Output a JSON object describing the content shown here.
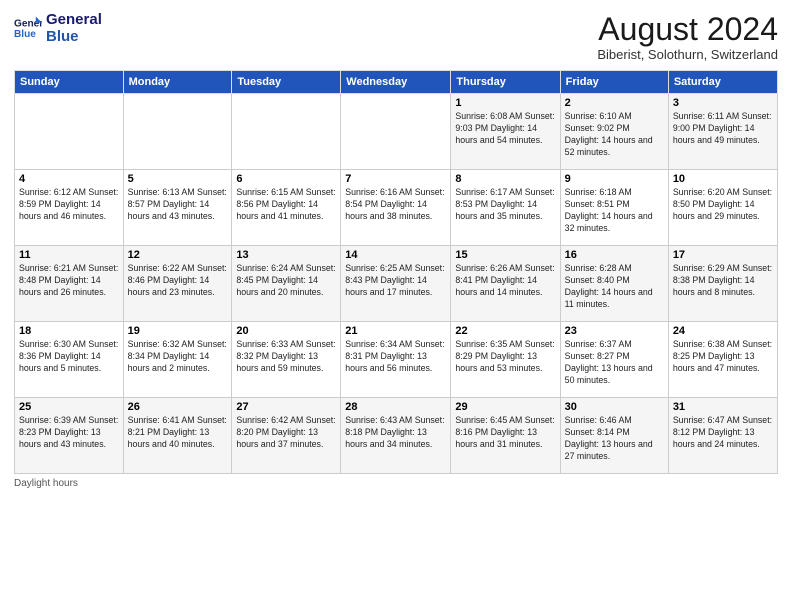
{
  "app": {
    "logo_line1": "General",
    "logo_line2": "Blue"
  },
  "header": {
    "month_year": "August 2024",
    "location": "Biberist, Solothurn, Switzerland"
  },
  "weekdays": [
    "Sunday",
    "Monday",
    "Tuesday",
    "Wednesday",
    "Thursday",
    "Friday",
    "Saturday"
  ],
  "footer": {
    "daylight_label": "Daylight hours"
  },
  "weeks": [
    [
      {
        "day": "",
        "info": ""
      },
      {
        "day": "",
        "info": ""
      },
      {
        "day": "",
        "info": ""
      },
      {
        "day": "",
        "info": ""
      },
      {
        "day": "1",
        "info": "Sunrise: 6:08 AM\nSunset: 9:03 PM\nDaylight: 14 hours\nand 54 minutes."
      },
      {
        "day": "2",
        "info": "Sunrise: 6:10 AM\nSunset: 9:02 PM\nDaylight: 14 hours\nand 52 minutes."
      },
      {
        "day": "3",
        "info": "Sunrise: 6:11 AM\nSunset: 9:00 PM\nDaylight: 14 hours\nand 49 minutes."
      }
    ],
    [
      {
        "day": "4",
        "info": "Sunrise: 6:12 AM\nSunset: 8:59 PM\nDaylight: 14 hours\nand 46 minutes."
      },
      {
        "day": "5",
        "info": "Sunrise: 6:13 AM\nSunset: 8:57 PM\nDaylight: 14 hours\nand 43 minutes."
      },
      {
        "day": "6",
        "info": "Sunrise: 6:15 AM\nSunset: 8:56 PM\nDaylight: 14 hours\nand 41 minutes."
      },
      {
        "day": "7",
        "info": "Sunrise: 6:16 AM\nSunset: 8:54 PM\nDaylight: 14 hours\nand 38 minutes."
      },
      {
        "day": "8",
        "info": "Sunrise: 6:17 AM\nSunset: 8:53 PM\nDaylight: 14 hours\nand 35 minutes."
      },
      {
        "day": "9",
        "info": "Sunrise: 6:18 AM\nSunset: 8:51 PM\nDaylight: 14 hours\nand 32 minutes."
      },
      {
        "day": "10",
        "info": "Sunrise: 6:20 AM\nSunset: 8:50 PM\nDaylight: 14 hours\nand 29 minutes."
      }
    ],
    [
      {
        "day": "11",
        "info": "Sunrise: 6:21 AM\nSunset: 8:48 PM\nDaylight: 14 hours\nand 26 minutes."
      },
      {
        "day": "12",
        "info": "Sunrise: 6:22 AM\nSunset: 8:46 PM\nDaylight: 14 hours\nand 23 minutes."
      },
      {
        "day": "13",
        "info": "Sunrise: 6:24 AM\nSunset: 8:45 PM\nDaylight: 14 hours\nand 20 minutes."
      },
      {
        "day": "14",
        "info": "Sunrise: 6:25 AM\nSunset: 8:43 PM\nDaylight: 14 hours\nand 17 minutes."
      },
      {
        "day": "15",
        "info": "Sunrise: 6:26 AM\nSunset: 8:41 PM\nDaylight: 14 hours\nand 14 minutes."
      },
      {
        "day": "16",
        "info": "Sunrise: 6:28 AM\nSunset: 8:40 PM\nDaylight: 14 hours\nand 11 minutes."
      },
      {
        "day": "17",
        "info": "Sunrise: 6:29 AM\nSunset: 8:38 PM\nDaylight: 14 hours\nand 8 minutes."
      }
    ],
    [
      {
        "day": "18",
        "info": "Sunrise: 6:30 AM\nSunset: 8:36 PM\nDaylight: 14 hours\nand 5 minutes."
      },
      {
        "day": "19",
        "info": "Sunrise: 6:32 AM\nSunset: 8:34 PM\nDaylight: 14 hours\nand 2 minutes."
      },
      {
        "day": "20",
        "info": "Sunrise: 6:33 AM\nSunset: 8:32 PM\nDaylight: 13 hours\nand 59 minutes."
      },
      {
        "day": "21",
        "info": "Sunrise: 6:34 AM\nSunset: 8:31 PM\nDaylight: 13 hours\nand 56 minutes."
      },
      {
        "day": "22",
        "info": "Sunrise: 6:35 AM\nSunset: 8:29 PM\nDaylight: 13 hours\nand 53 minutes."
      },
      {
        "day": "23",
        "info": "Sunrise: 6:37 AM\nSunset: 8:27 PM\nDaylight: 13 hours\nand 50 minutes."
      },
      {
        "day": "24",
        "info": "Sunrise: 6:38 AM\nSunset: 8:25 PM\nDaylight: 13 hours\nand 47 minutes."
      }
    ],
    [
      {
        "day": "25",
        "info": "Sunrise: 6:39 AM\nSunset: 8:23 PM\nDaylight: 13 hours\nand 43 minutes."
      },
      {
        "day": "26",
        "info": "Sunrise: 6:41 AM\nSunset: 8:21 PM\nDaylight: 13 hours\nand 40 minutes."
      },
      {
        "day": "27",
        "info": "Sunrise: 6:42 AM\nSunset: 8:20 PM\nDaylight: 13 hours\nand 37 minutes."
      },
      {
        "day": "28",
        "info": "Sunrise: 6:43 AM\nSunset: 8:18 PM\nDaylight: 13 hours\nand 34 minutes."
      },
      {
        "day": "29",
        "info": "Sunrise: 6:45 AM\nSunset: 8:16 PM\nDaylight: 13 hours\nand 31 minutes."
      },
      {
        "day": "30",
        "info": "Sunrise: 6:46 AM\nSunset: 8:14 PM\nDaylight: 13 hours\nand 27 minutes."
      },
      {
        "day": "31",
        "info": "Sunrise: 6:47 AM\nSunset: 8:12 PM\nDaylight: 13 hours\nand 24 minutes."
      }
    ]
  ]
}
